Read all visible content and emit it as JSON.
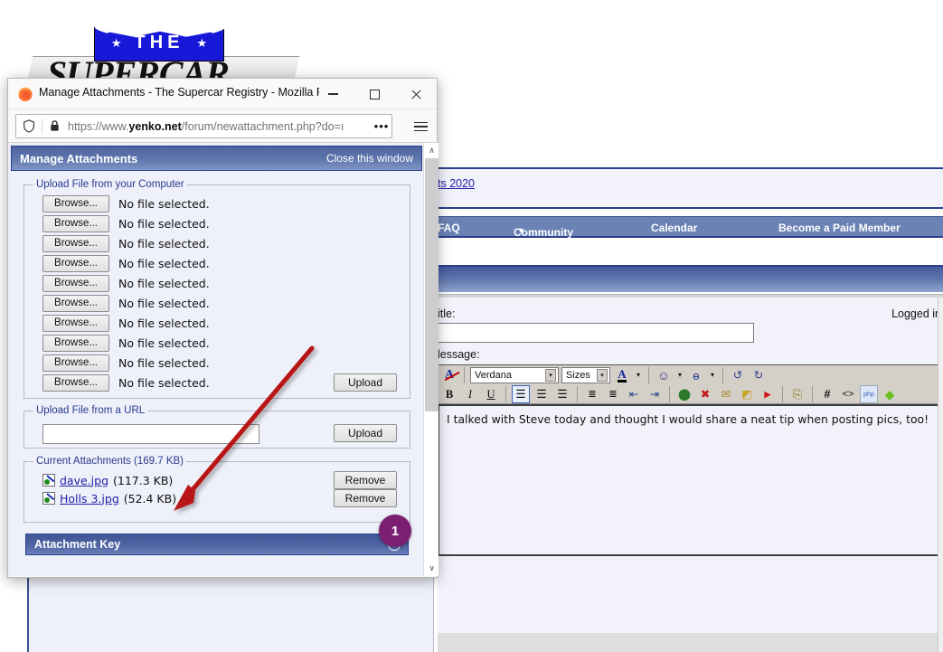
{
  "browser": {
    "window_title": "Manage Attachments - The Supercar Registry - Mozilla Fir...",
    "favicon": "firefox-icon",
    "minimize_label": "Minimize",
    "maximize_label": "Maximize",
    "close_label": "Close",
    "url_scheme": "https://www.",
    "url_domain": "yenko.net",
    "url_path": "/forum/newattachment.php?do=ı",
    "page_actions_label": "•••",
    "menu_label": "Open menu",
    "shield_icon": "shield-icon",
    "lock_icon": "padlock-icon"
  },
  "popup": {
    "header_title": "Manage Attachments",
    "close_window_link": "Close this window",
    "local_group": {
      "legend": "Upload File from your Computer",
      "browse_label": "Browse...",
      "no_file_text": "No file selected.",
      "row_count": 10,
      "upload_label": "Upload"
    },
    "url_group": {
      "legend": "Upload File from a URL",
      "input_value": "",
      "input_placeholder": "",
      "upload_label": "Upload"
    },
    "current_group": {
      "legend": "Current Attachments (169.7 KB)",
      "remove_label": "Remove",
      "attachments": [
        {
          "icon": "image-file-icon",
          "name": "dave.jpg",
          "size": "(117.3 KB)"
        },
        {
          "icon": "image-file-icon",
          "name": "Holls 3.jpg",
          "size": "(52.4 KB)"
        }
      ]
    },
    "attachment_key": {
      "title": "Attachment Key",
      "collapse_icon": "collapse-icon"
    },
    "scrollbar": {
      "up_arrow": "∧",
      "down_arrow": "∨"
    }
  },
  "background_page": {
    "logo": {
      "top_text": "THE",
      "main_text": "SUPERCAR",
      "star": "★"
    },
    "breadcrumb_partial": "ts 2020",
    "nav_items": [
      {
        "label": "FAQ",
        "has_caret": false
      },
      {
        "label": "Community",
        "has_caret": true
      },
      {
        "label": "Calendar",
        "has_caret": false
      },
      {
        "label": "Become a Paid Member",
        "has_caret": false
      }
    ],
    "caret": "▼",
    "form": {
      "title_label": "itle:",
      "title_value": "",
      "logged_in_text": "Logged in",
      "message_label": "lessage:",
      "message_text": "I talked with Steve today and thought I would share  a neat tip when posting pics, too!"
    },
    "editor_toolbar": {
      "font_family_value": "Verdana",
      "font_size_value": "Sizes",
      "row1": [
        {
          "name": "remove-formatting-icon",
          "glyph": "A"
        },
        {
          "name": "font-family-select",
          "glyph": ""
        },
        {
          "name": "font-size-select",
          "glyph": ""
        },
        {
          "name": "font-color-icon",
          "glyph": "A"
        },
        {
          "name": "font-color-dropdown-icon",
          "glyph": "▾"
        },
        {
          "name": "smilie-icon",
          "glyph": "☺"
        },
        {
          "name": "smilie-dropdown-icon",
          "glyph": "▾"
        },
        {
          "name": "attachment-icon",
          "glyph": "ɵ"
        },
        {
          "name": "attachment-dropdown-icon",
          "glyph": "▾"
        },
        {
          "name": "undo-icon",
          "glyph": "↶"
        },
        {
          "name": "redo-icon",
          "glyph": "↷"
        }
      ],
      "row2": [
        {
          "name": "bold-icon",
          "glyph": "B"
        },
        {
          "name": "italic-icon",
          "glyph": "I"
        },
        {
          "name": "underline-icon",
          "glyph": "U"
        },
        {
          "name": "align-left-icon",
          "glyph": "≡"
        },
        {
          "name": "align-center-icon",
          "glyph": "≡"
        },
        {
          "name": "align-right-icon",
          "glyph": "≡"
        },
        {
          "name": "ordered-list-icon",
          "glyph": "≣"
        },
        {
          "name": "unordered-list-icon",
          "glyph": "≣"
        },
        {
          "name": "outdent-icon",
          "glyph": "⇤"
        },
        {
          "name": "indent-icon",
          "glyph": "⇥"
        },
        {
          "name": "insert-link-icon",
          "glyph": "●"
        },
        {
          "name": "remove-link-icon",
          "glyph": "✖"
        },
        {
          "name": "insert-email-icon",
          "glyph": "✉"
        },
        {
          "name": "insert-image-icon",
          "glyph": "◩"
        },
        {
          "name": "insert-video-icon",
          "glyph": "▶"
        },
        {
          "name": "wrap-quote-icon",
          "glyph": "⎘"
        },
        {
          "name": "insert-hash-icon",
          "glyph": "#"
        },
        {
          "name": "insert-code-icon",
          "glyph": "<>"
        },
        {
          "name": "insert-php-icon",
          "glyph": "php"
        },
        {
          "name": "insert-highlight-icon",
          "glyph": "◆"
        }
      ]
    }
  },
  "annotations": {
    "step_badge": "1",
    "arrow_color": "#b81414",
    "badge_color": "#7b1f72"
  }
}
